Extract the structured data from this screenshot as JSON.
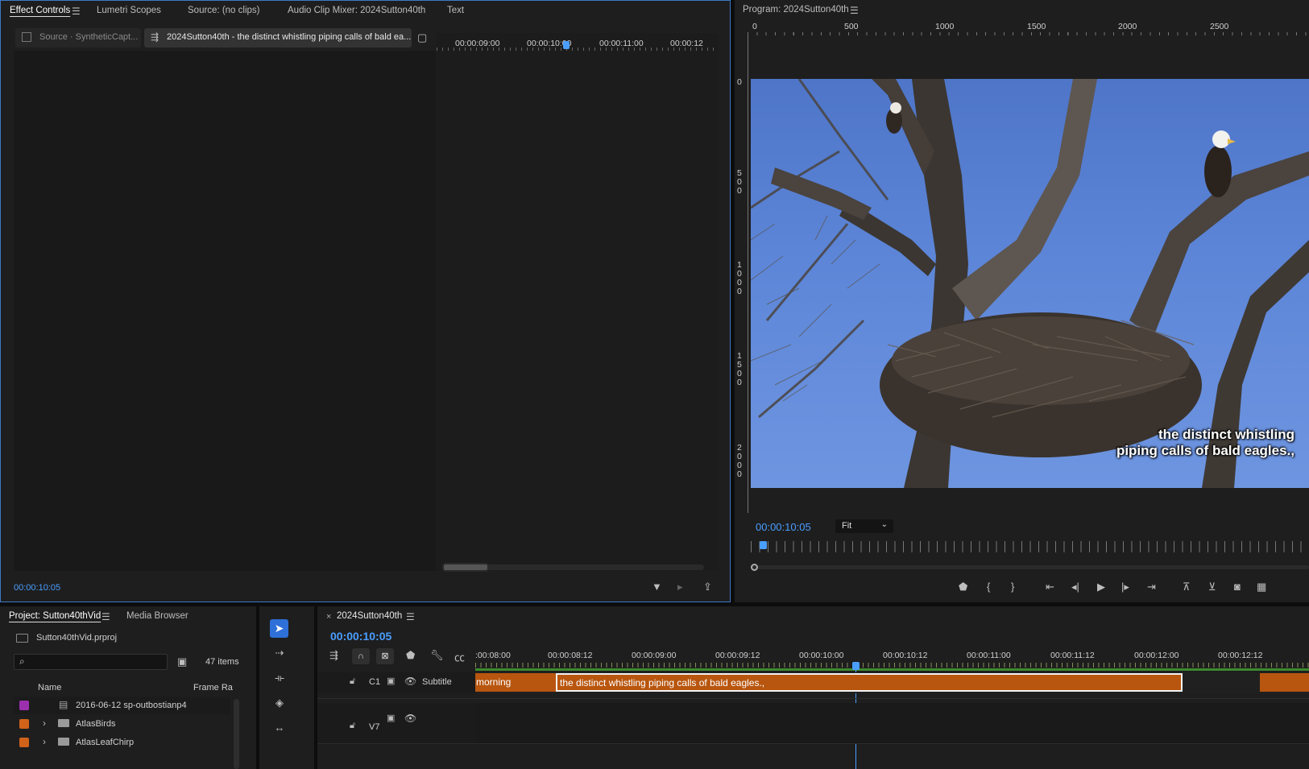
{
  "effect_panel": {
    "tabs": [
      "Effect Controls",
      "Lumetri Scopes",
      "Source: (no clips)",
      "Audio Clip Mixer: 2024Sutton40th",
      "Text"
    ],
    "source_chip": "Source · SyntheticCapt...",
    "sequence_chip": "2024Sutton40th - the distinct whistling piping calls of bald ea...",
    "ruler": [
      "00:00:09:00",
      "00:00:10:00",
      "00:00:11:00",
      "00:00:12"
    ],
    "timecode": "00:00:10:05"
  },
  "program_panel": {
    "title": "Program: 2024Sutton40th",
    "h_ruler": [
      "0",
      "500",
      "1000",
      "1500",
      "2000",
      "2500"
    ],
    "v_ruler": [
      "0",
      "500",
      "1000",
      "1500",
      "2000"
    ],
    "caption_lines": [
      "the distinct whistling",
      "piping calls of bald eagles.,"
    ],
    "timecode": "00:00:10:05",
    "fit_option": "Fit"
  },
  "project_panel": {
    "tabs": [
      "Project: Sutton40thVid",
      "Media Browser"
    ],
    "file": "Sutton40thVid.prproj",
    "items_count": "47 items",
    "columns": [
      "Name",
      "Frame Ra"
    ],
    "rows": [
      {
        "name": "2016-06-12 sp-outbostianp4",
        "color": "#9b2fae",
        "kind": "clip"
      },
      {
        "name": "AtlasBirds",
        "color": "#d0621a",
        "kind": "folder"
      },
      {
        "name": "AtlasLeafChirp",
        "color": "#d0621a",
        "kind": "folder"
      }
    ]
  },
  "timeline": {
    "tab": "2024Sutton40th",
    "timecode": "00:00:10:05",
    "ruler": [
      ":00:08:00",
      "00:00:08:12",
      "00:00:09:00",
      "00:00:09:12",
      "00:00:10:00",
      "00:00:10:12",
      "00:00:11:00",
      "00:00:11:12",
      "00:00:12:00",
      "00:00:12:12"
    ],
    "tracks": [
      {
        "lock": "C1",
        "name": "Subtitle"
      },
      {
        "lock": "V7",
        "name": ""
      }
    ],
    "clips": [
      "morning",
      "the distinct whistling piping calls of bald eagles.,"
    ]
  },
  "colors": {
    "accent": "#4a9eff",
    "clip": "#b8560f",
    "caption_track": "#3c8a2e"
  }
}
